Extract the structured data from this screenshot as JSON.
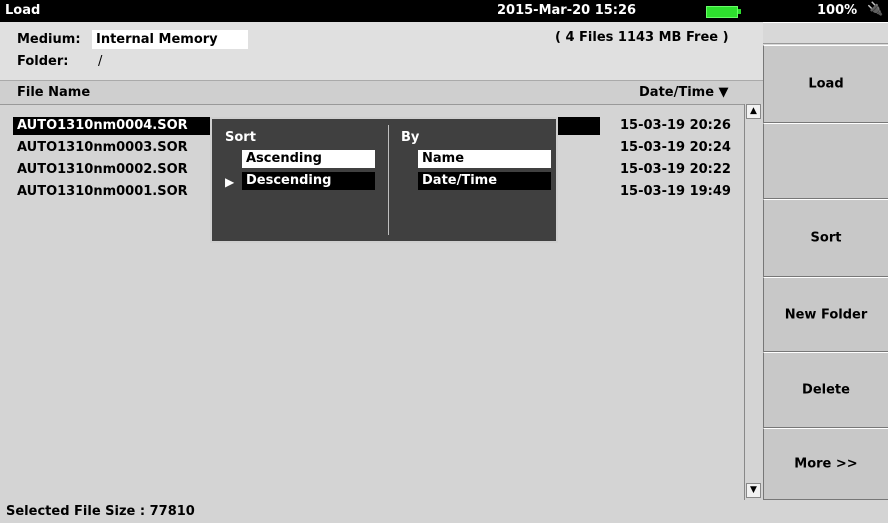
{
  "topbar": {
    "title": "Load",
    "datetime": "2015-Mar-20 15:26",
    "battery_pct": "100%",
    "battery_color": "#2ee02e"
  },
  "info": {
    "medium_label": "Medium:",
    "medium_value": "Internal Memory",
    "folder_label": "Folder:",
    "folder_value": "/",
    "files_summary": "( 4 Files   1143 MB Free )"
  },
  "columns": {
    "file_name": "File Name",
    "date_time": "Date/Time ▼"
  },
  "files": [
    {
      "name": "AUTO1310nm0004.SOR",
      "date": "15-03-19 20:26"
    },
    {
      "name": "AUTO1310nm0003.SOR",
      "date": "15-03-19 20:24"
    },
    {
      "name": "AUTO1310nm0002.SOR",
      "date": "15-03-19 20:22"
    },
    {
      "name": "AUTO1310nm0001.SOR",
      "date": "15-03-19 19:49"
    }
  ],
  "sort_popup": {
    "sort_heading": "Sort",
    "by_heading": "By",
    "ascending": "Ascending",
    "descending": "Descending",
    "by_name": "Name",
    "by_datetime": "Date/Time",
    "pointer": "▶"
  },
  "softkeys": {
    "load": "Load",
    "blank": "",
    "sort": "Sort",
    "new_folder": "New Folder",
    "delete": "Delete",
    "more": "More >>"
  },
  "status": {
    "selected_size": "Selected File Size : 77810"
  }
}
